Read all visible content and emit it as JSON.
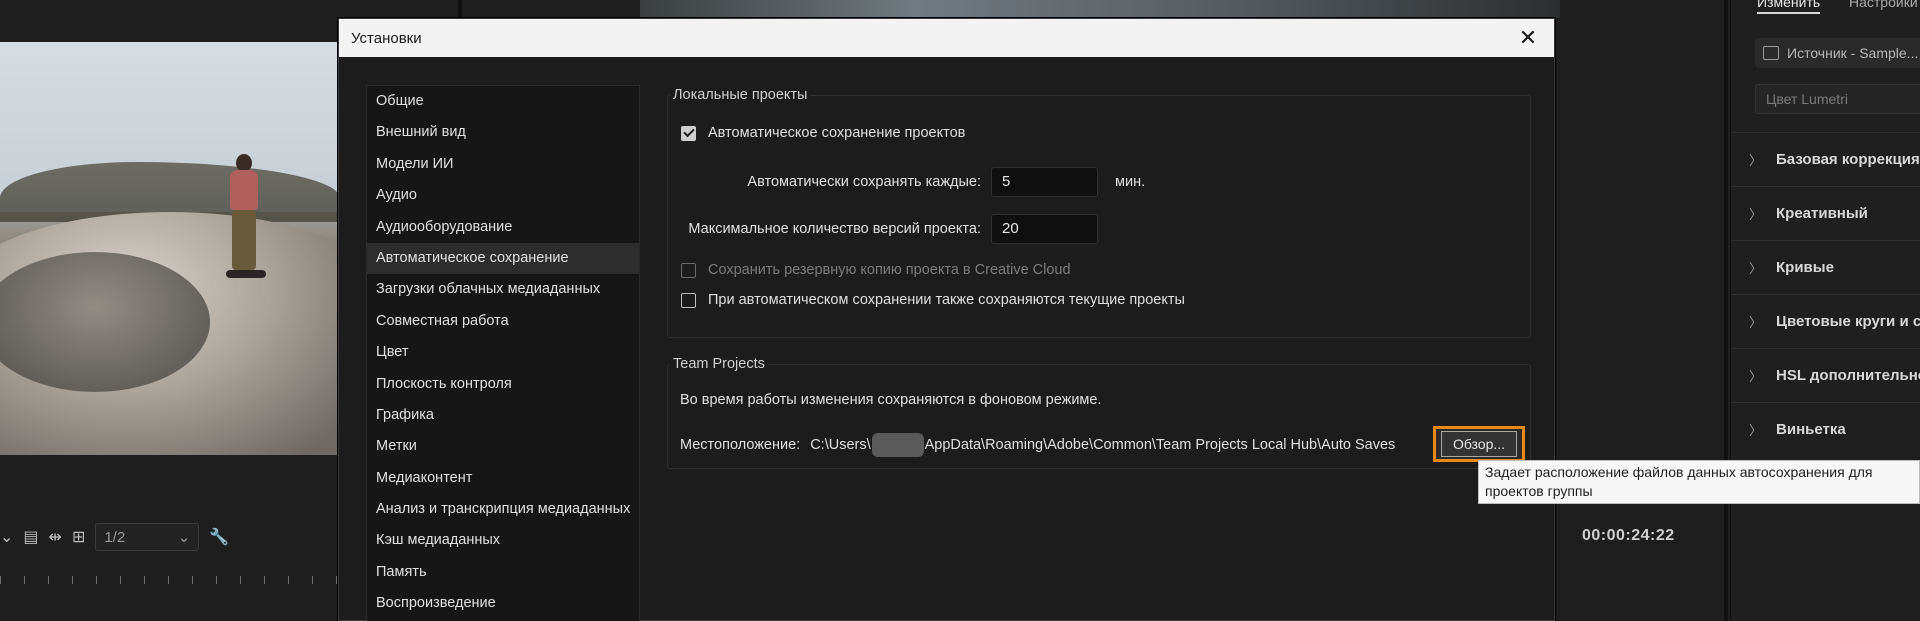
{
  "background": {
    "transport": {
      "zoom_value": "1/2",
      "timecode": "00:00:24:22"
    },
    "lumetri": {
      "tabs": [
        "Изменить",
        "Настройки"
      ],
      "source_label": "Источник - Sample...",
      "preset_placeholder": "Цвет Lumetri",
      "sections": [
        {
          "label": "Базовая коррекция"
        },
        {
          "label": "Креативный"
        },
        {
          "label": "Кривые"
        },
        {
          "label": "Цветовые круги и соп"
        },
        {
          "label": "HSL дополнительно"
        },
        {
          "label": "Виньетка"
        }
      ]
    }
  },
  "dialog": {
    "title": "Установки",
    "close_glyph": "✕",
    "categories": [
      {
        "label": "Общие"
      },
      {
        "label": "Внешний вид"
      },
      {
        "label": "Модели ИИ"
      },
      {
        "label": "Аудио"
      },
      {
        "label": "Аудиооборудование"
      },
      {
        "label": "Автоматическое сохранение",
        "selected": true
      },
      {
        "label": "Загрузки облачных медиаданных"
      },
      {
        "label": "Совместная работа"
      },
      {
        "label": "Цвет"
      },
      {
        "label": "Плоскость контроля"
      },
      {
        "label": "Графика"
      },
      {
        "label": "Метки"
      },
      {
        "label": "Медиаконтент"
      },
      {
        "label": "Анализ и транскрипция медиаданных"
      },
      {
        "label": "Кэш медиаданных"
      },
      {
        "label": "Память"
      },
      {
        "label": "Воспроизведение"
      }
    ],
    "local_projects": {
      "group_title": "Локальные проекты",
      "autosave_label": "Автоматическое сохранение проектов",
      "autosave_checked": true,
      "interval_label": "Автоматически сохранять каждые:",
      "interval_value": "5",
      "interval_unit": "мин.",
      "max_versions_label": "Максимальное количество версий проекта:",
      "max_versions_value": "20",
      "cloud_backup_label": "Сохранить резервную копию проекта в Creative Cloud",
      "cloud_backup_checked": false,
      "cloud_backup_enabled": false,
      "save_current_label": "При автоматическом сохранении также сохраняются текущие проекты",
      "save_current_checked": false
    },
    "team_projects": {
      "group_title": "Team Projects",
      "info_text": "Во время работы изменения сохраняются в фоновом режиме.",
      "location_label": "Местоположение:",
      "path_prefix": "C:\\Users\\",
      "path_suffix": "AppData\\Roaming\\Adobe\\Common\\Team Projects Local Hub\\Auto Saves",
      "browse_label": "Обзор..."
    },
    "tooltip": "Задает расположение файлов данных автосохранения для проектов группы"
  },
  "colors": {
    "highlight": "#e68a15",
    "dialog_bg": "#1c1c1c",
    "titlebar_bg": "#f3f3f3"
  }
}
